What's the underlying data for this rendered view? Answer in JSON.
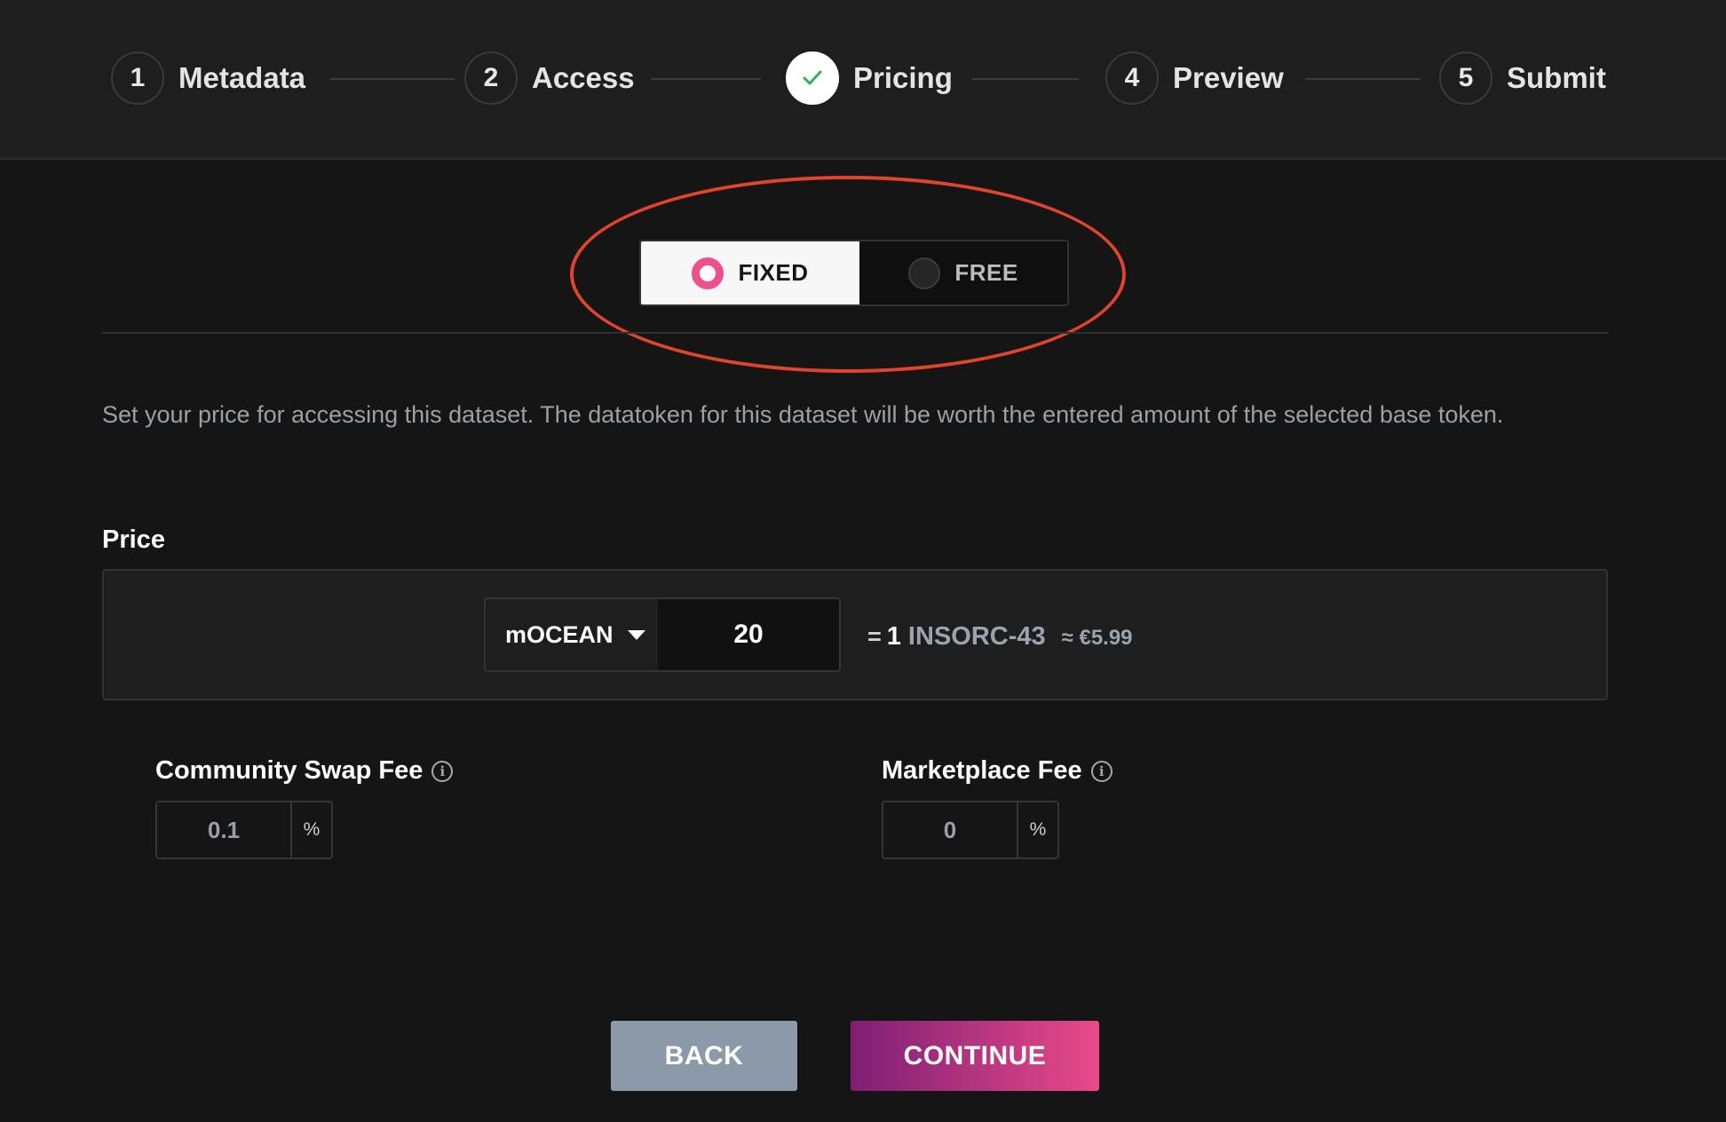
{
  "steps": [
    {
      "number": "1",
      "label": "Metadata",
      "state": "pending"
    },
    {
      "number": "2",
      "label": "Access",
      "state": "pending"
    },
    {
      "number": "",
      "label": "Pricing",
      "state": "completed"
    },
    {
      "number": "4",
      "label": "Preview",
      "state": "pending"
    },
    {
      "number": "5",
      "label": "Submit",
      "state": "pending"
    }
  ],
  "pricing_type": {
    "options": [
      {
        "label": "FIXED",
        "selected": true
      },
      {
        "label": "FREE",
        "selected": false
      }
    ]
  },
  "help_text": "Set your price for accessing this dataset. The datatoken for this dataset will be worth the entered amount of the selected base token.",
  "price": {
    "label": "Price",
    "base_token": "mOCEAN",
    "value": "20",
    "conversion_eq": "=",
    "conversion_amount": "1",
    "datatoken_symbol": "INSORC-43",
    "fiat_estimate": "≈ €5.99"
  },
  "fees": {
    "community_swap": {
      "label": "Community Swap Fee",
      "value": "0.1",
      "unit": "%"
    },
    "marketplace": {
      "label": "Marketplace Fee",
      "value": "0",
      "unit": "%"
    }
  },
  "buttons": {
    "back": "BACK",
    "continue": "CONTINUE"
  },
  "colors": {
    "accent_pink": "#ee4f8d",
    "highlight_red": "#e0442b",
    "back_button": "#8c99a8",
    "continue_gradient_start": "#7e1f74",
    "continue_gradient_end": "#e94a8a"
  },
  "icons": {
    "step_completed": "check-icon",
    "fee_info": "info-icon",
    "select_caret": "caret-down-icon"
  }
}
